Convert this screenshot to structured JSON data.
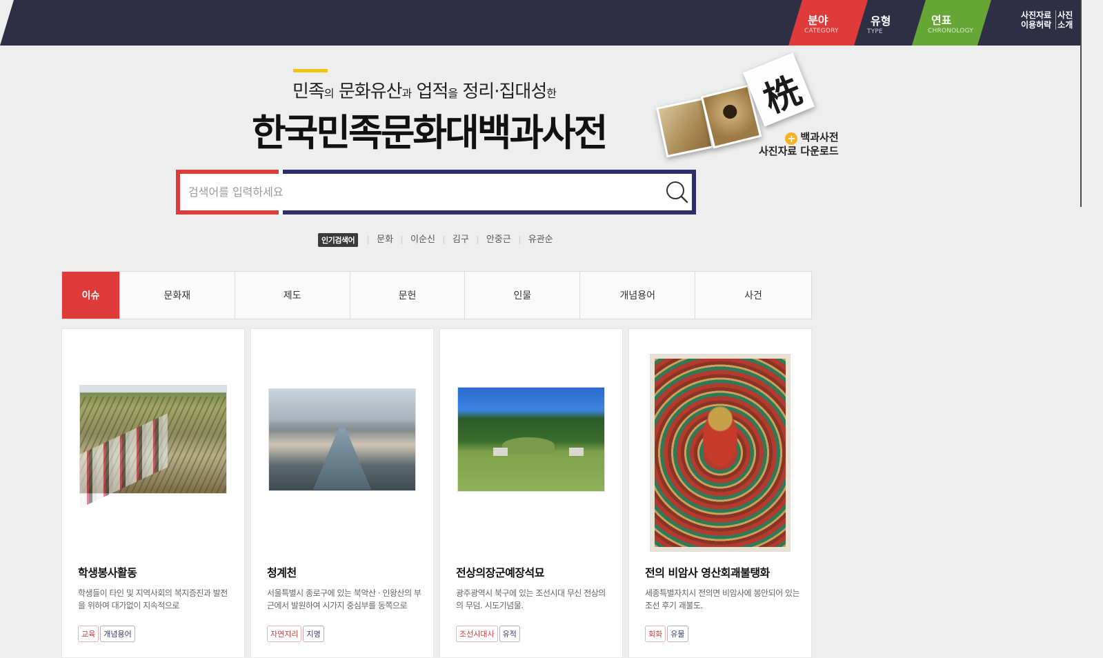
{
  "topnav": {
    "category": {
      "ko": "분야",
      "en": "CATEGORY"
    },
    "type": {
      "ko": "유형",
      "en": "TYPE"
    },
    "chronology": {
      "ko": "연표",
      "en": "CHRONOLOGY"
    },
    "photo_license": {
      "line1": "사진자료",
      "line2": "이용허락"
    },
    "photo_intro": {
      "line1": "사진",
      "line2": "소개"
    }
  },
  "hero": {
    "subtitle_parts": [
      "민족",
      "의",
      " 문화유산",
      "과",
      " 업적",
      "을",
      " 정리·집대성",
      "한"
    ],
    "title": "한국민족문화대백과사전",
    "photo_glyph": "㭠",
    "download": {
      "line1": "백과사전",
      "line2": "사진자료 다운로드"
    }
  },
  "search": {
    "placeholder": "검색어를 입력하세요",
    "value": ""
  },
  "popular": {
    "badge": "인기검색어",
    "keywords": [
      "문화",
      "이순신",
      "김구",
      "안중근",
      "유관순"
    ]
  },
  "tabs": [
    "이슈",
    "문화재",
    "제도",
    "문헌",
    "인물",
    "개념용어",
    "사건"
  ],
  "cards": [
    {
      "title": "학생봉사활동",
      "desc": "학생들이 타인 및 지역사회의 복지증진과 발전을 위하여 대가없이 지속적으로",
      "tags": [
        "교육",
        "개념용어"
      ]
    },
    {
      "title": "청계천",
      "desc": "서울특별시 종로구에 있는 북악산 · 인왕산의 부근에서 발원하여 시가지 중심부를 동쪽으로",
      "tags": [
        "자연지리",
        "지명"
      ]
    },
    {
      "title": "전상의장군예장석묘",
      "desc": "광주광역시 북구에 있는 조선시대 무신 전상의의 무덤. 시도기념물.",
      "tags": [
        "조선시대사",
        "유적"
      ]
    },
    {
      "title": "전의 비암사 영산회괘불탱화",
      "desc": "세종특별자치시 전의면 비암사에 봉안되어 있는 조선 후기 괘불도.",
      "tags": [
        "회화",
        "유물"
      ]
    }
  ],
  "colors": {
    "navy": "#2e2f44",
    "red": "#e03b3b",
    "green": "#65a637",
    "accent": "#f1c40f"
  }
}
